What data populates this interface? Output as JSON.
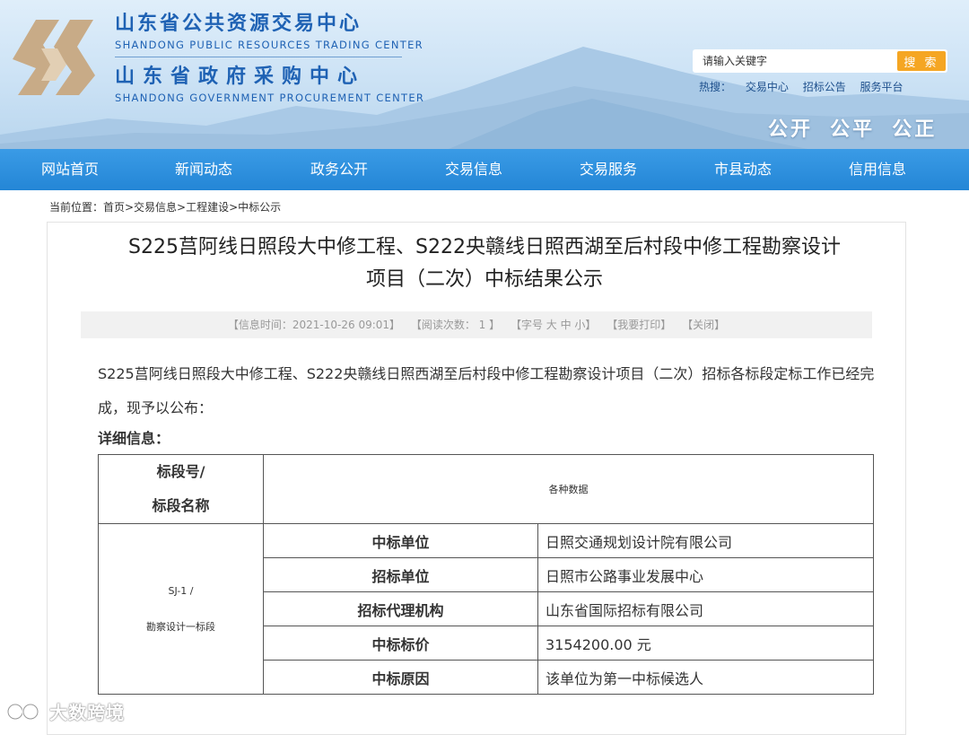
{
  "header": {
    "name_cn_1": "山东省公共资源交易中心",
    "name_en_1": "SHANDONG PUBLIC RESOURCES TRADING CENTER",
    "name_cn_2": "山东省政府采购中心",
    "name_en_2": "SHANDONG GOVERNMENT PROCUREMENT CENTER",
    "search": {
      "placeholder": "请输入关键字",
      "button": "搜 索"
    },
    "hot_search": {
      "label": "热搜：",
      "links": [
        "交易中心",
        "招标公告",
        "服务平台"
      ]
    },
    "slogan": [
      "公开",
      "公平",
      "公正"
    ]
  },
  "nav": {
    "items": [
      "网站首页",
      "新闻动态",
      "政务公开",
      "交易信息",
      "交易服务",
      "市县动态",
      "信用信息"
    ]
  },
  "breadcrumb": "当前位置：首页>交易信息>工程建设>中标公示",
  "article": {
    "title_line1": "S225莒阿线日照段大中修工程、S222央赣线日照西湖至后村段中修工程勘察设计",
    "title_line2": "项目（二次）中标结果公示",
    "info": {
      "time": "【信息时间：2021-10-26 09:01】",
      "views": "【阅读次数： 1 】",
      "font": "【字号 大 中 小】",
      "print": "【我要打印】",
      "close": "【关闭】"
    },
    "intro": "S225莒阿线日照段大中修工程、S222央赣线日照西湖至后村段中修工程勘察设计项目（二次）招标各标段定标工作已经完成，现予以公布：",
    "detail_label": "详细信息：",
    "table": {
      "header_col1_line1": "标段号/",
      "header_col1_line2": "标段名称",
      "header_col2": "各种数据",
      "section_line1": "SJ-1 /",
      "section_line2": "勘察设计一标段",
      "rows": [
        {
          "key": "中标单位",
          "value": "日照交通规划设计院有限公司"
        },
        {
          "key": "招标单位",
          "value": "日照市公路事业发展中心"
        },
        {
          "key": "招标代理机构",
          "value": "山东省国际招标有限公司"
        },
        {
          "key": "中标标价",
          "value": "3154200.00 元"
        },
        {
          "key": "中标原因",
          "value": "该单位为第一中标候选人"
        }
      ]
    }
  },
  "watermark": "大数跨境",
  "colors": {
    "brand_blue": "#1f62b4",
    "nav_blue": "#2486d6",
    "search_orange": "#f5a623"
  }
}
